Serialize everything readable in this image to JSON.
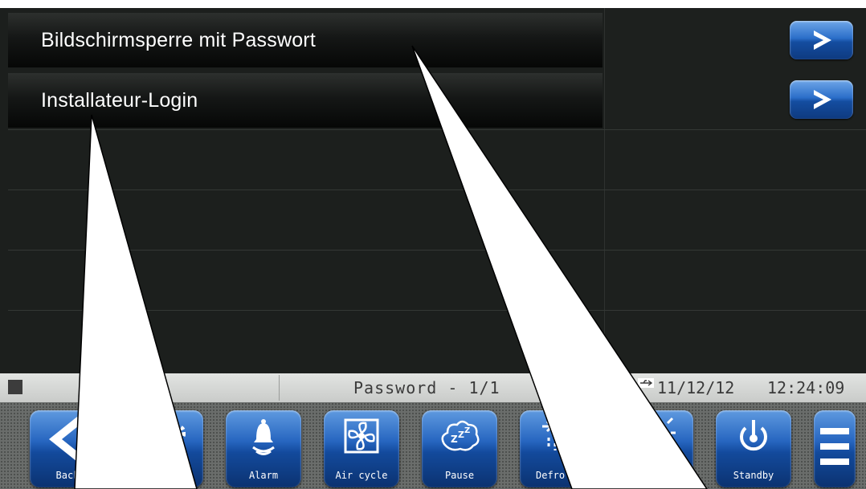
{
  "menu": {
    "items": [
      {
        "label": "Bildschirmsperre mit Passwort"
      },
      {
        "label": "Installateur-Login"
      }
    ]
  },
  "statusbar": {
    "title": "Password - 1/1",
    "date": "11/12/12",
    "time": "12:24:09"
  },
  "toolbar": {
    "buttons": [
      {
        "label": "Back",
        "icon": "chevron-left-icon"
      },
      {
        "label": "s",
        "icon": "gear-icon"
      },
      {
        "label": "Alarm",
        "icon": "bell-icon"
      },
      {
        "label": "Air cycle",
        "icon": "fan-icon"
      },
      {
        "label": "Pause",
        "icon": "sleep-cloud-icon"
      },
      {
        "label": "Defro",
        "icon": "defrost-icon"
      },
      {
        "label": "",
        "icon": "light-icon"
      },
      {
        "label": "Standby",
        "icon": "power-icon"
      }
    ],
    "menu_icon": "hamburger-menu-icon"
  },
  "colors": {
    "background": "#1c1f1d",
    "button_blue": "#2766c0",
    "statusbar": "#d6d8d6"
  }
}
